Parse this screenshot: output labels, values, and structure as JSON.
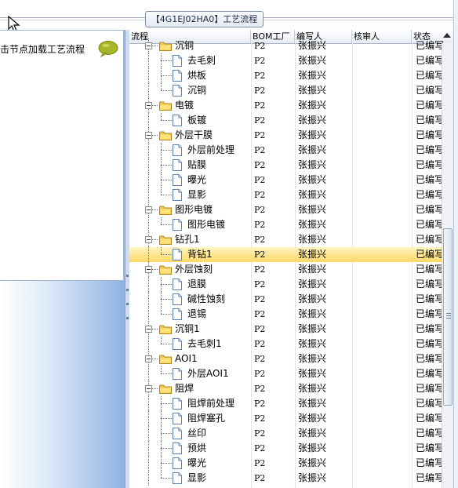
{
  "window": {
    "title": "【4G1EJ02HA0】工艺流程"
  },
  "left_panel": {
    "hint": "击节点加载工艺流程"
  },
  "grid": {
    "columns": {
      "flow": "流程",
      "bom": "BOM工厂",
      "author": "编写人",
      "reviewer": "核审人",
      "status": "状态"
    },
    "rows": [
      {
        "name": "沉铜",
        "level": 0,
        "type": "folder",
        "bom": "P2",
        "author": "张振兴",
        "reviewer": "",
        "status": "已编写"
      },
      {
        "name": "去毛刺",
        "level": 1,
        "type": "doc",
        "bom": "P2",
        "author": "张振兴",
        "reviewer": "",
        "status": "已编写"
      },
      {
        "name": "烘板",
        "level": 1,
        "type": "doc",
        "bom": "P2",
        "author": "张振兴",
        "reviewer": "",
        "status": "已编写"
      },
      {
        "name": "沉铜",
        "level": 1,
        "type": "doc",
        "bom": "P2",
        "author": "张振兴",
        "reviewer": "",
        "status": "已编写"
      },
      {
        "name": "电镀",
        "level": 0,
        "type": "folder",
        "bom": "P2",
        "author": "张振兴",
        "reviewer": "",
        "status": "已编写"
      },
      {
        "name": "板镀",
        "level": 1,
        "type": "doc",
        "bom": "P2",
        "author": "张振兴",
        "reviewer": "",
        "status": "已编写"
      },
      {
        "name": "外层干膜",
        "level": 0,
        "type": "folder",
        "bom": "P2",
        "author": "张振兴",
        "reviewer": "",
        "status": "已编写"
      },
      {
        "name": "外层前处理",
        "level": 1,
        "type": "doc",
        "bom": "P2",
        "author": "张振兴",
        "reviewer": "",
        "status": "已编写"
      },
      {
        "name": "贴膜",
        "level": 1,
        "type": "doc",
        "bom": "P2",
        "author": "张振兴",
        "reviewer": "",
        "status": "已编写"
      },
      {
        "name": "曝光",
        "level": 1,
        "type": "doc",
        "bom": "P2",
        "author": "张振兴",
        "reviewer": "",
        "status": "已编写"
      },
      {
        "name": "显影",
        "level": 1,
        "type": "doc",
        "bom": "P2",
        "author": "张振兴",
        "reviewer": "",
        "status": "已编写"
      },
      {
        "name": "图形电镀",
        "level": 0,
        "type": "folder",
        "bom": "P2",
        "author": "张振兴",
        "reviewer": "",
        "status": "已编写"
      },
      {
        "name": "图形电镀",
        "level": 1,
        "type": "doc",
        "bom": "P2",
        "author": "张振兴",
        "reviewer": "",
        "status": "已编写"
      },
      {
        "name": "钻孔1",
        "level": 0,
        "type": "folder",
        "bom": "P2",
        "author": "张振兴",
        "reviewer": "",
        "status": "已编写"
      },
      {
        "name": "背钻1",
        "level": 1,
        "type": "doc",
        "bom": "P2",
        "author": "张振兴",
        "reviewer": "",
        "status": "已编写",
        "selected": true
      },
      {
        "name": "外层蚀刻",
        "level": 0,
        "type": "folder",
        "bom": "P2",
        "author": "张振兴",
        "reviewer": "",
        "status": "已编写"
      },
      {
        "name": "退膜",
        "level": 1,
        "type": "doc",
        "bom": "P2",
        "author": "张振兴",
        "reviewer": "",
        "status": "已编写"
      },
      {
        "name": "碱性蚀刻",
        "level": 1,
        "type": "doc",
        "bom": "P2",
        "author": "张振兴",
        "reviewer": "",
        "status": "已编写"
      },
      {
        "name": "退锡",
        "level": 1,
        "type": "doc",
        "bom": "P2",
        "author": "张振兴",
        "reviewer": "",
        "status": "已编写"
      },
      {
        "name": "沉铜1",
        "level": 0,
        "type": "folder",
        "bom": "P2",
        "author": "张振兴",
        "reviewer": "",
        "status": "已编写"
      },
      {
        "name": "去毛刺1",
        "level": 1,
        "type": "doc",
        "bom": "P2",
        "author": "张振兴",
        "reviewer": "",
        "status": "已编写"
      },
      {
        "name": "AOI1",
        "level": 0,
        "type": "folder",
        "bom": "P2",
        "author": "张振兴",
        "reviewer": "",
        "status": "已编写"
      },
      {
        "name": "外层AOI1",
        "level": 1,
        "type": "doc",
        "bom": "P2",
        "author": "张振兴",
        "reviewer": "",
        "status": "已编写"
      },
      {
        "name": "阻焊",
        "level": 0,
        "type": "folder",
        "bom": "P2",
        "author": "张振兴",
        "reviewer": "",
        "status": "已编写"
      },
      {
        "name": "阻焊前处理",
        "level": 1,
        "type": "doc",
        "bom": "P2",
        "author": "张振兴",
        "reviewer": "",
        "status": "已编写"
      },
      {
        "name": "阻焊塞孔",
        "level": 1,
        "type": "doc",
        "bom": "P2",
        "author": "张振兴",
        "reviewer": "",
        "status": "已编写"
      },
      {
        "name": "丝印",
        "level": 1,
        "type": "doc",
        "bom": "P2",
        "author": "张振兴",
        "reviewer": "",
        "status": "已编写"
      },
      {
        "name": "预烘",
        "level": 1,
        "type": "doc",
        "bom": "P2",
        "author": "张振兴",
        "reviewer": "",
        "status": "已编写"
      },
      {
        "name": "曝光",
        "level": 1,
        "type": "doc",
        "bom": "P2",
        "author": "张振兴",
        "reviewer": "",
        "status": "已编写"
      },
      {
        "name": "显影",
        "level": 1,
        "type": "doc",
        "bom": "P2",
        "author": "张振兴",
        "reviewer": "",
        "status": "已编写"
      }
    ]
  },
  "colors": {
    "selected_top": "#fff4c2",
    "selected_bottom": "#ffd866",
    "folder": "#f2c94c",
    "panel_gradient": "#8eb3e3"
  }
}
